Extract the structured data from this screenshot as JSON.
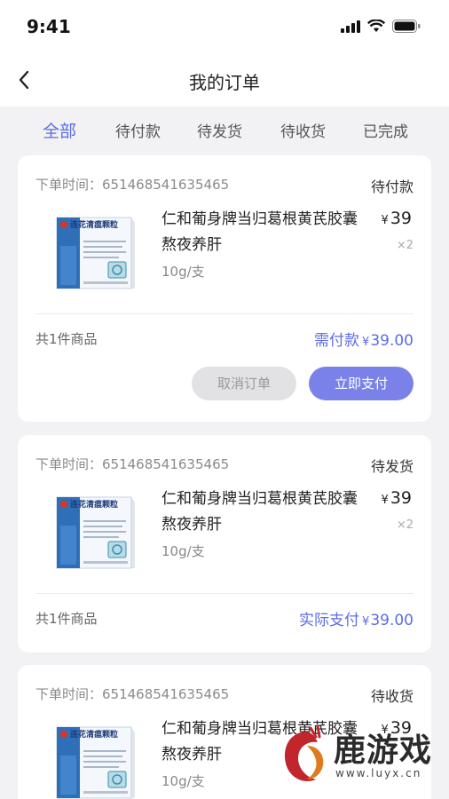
{
  "status_bar": {
    "time": "9:41"
  },
  "header": {
    "title": "我的订单"
  },
  "tabs": [
    {
      "label": "全部",
      "active": true
    },
    {
      "label": "待付款",
      "active": false
    },
    {
      "label": "待发货",
      "active": false
    },
    {
      "label": "待收货",
      "active": false
    },
    {
      "label": "已完成",
      "active": false
    }
  ],
  "orders": [
    {
      "time_label": "下单时间：651468541635465",
      "status": "待付款",
      "product": {
        "name": "仁和葡身牌当归葛根黄芪胶囊熬夜养肝",
        "spec": "10g/支",
        "price_symbol": "¥",
        "price": "39",
        "qty": "×2",
        "box_label": "连花清瘟颗粒"
      },
      "item_count": "共1件商品",
      "total_label": "需付款",
      "total_symbol": "¥",
      "total_value": "39.00",
      "cancel_label": "取消订单",
      "pay_label": "立即支付"
    },
    {
      "time_label": "下单时间：651468541635465",
      "status": "待发货",
      "product": {
        "name": "仁和葡身牌当归葛根黄芪胶囊熬夜养肝",
        "spec": "10g/支",
        "price_symbol": "¥",
        "price": "39",
        "qty": "×2",
        "box_label": "连花清瘟颗粒"
      },
      "item_count": "共1件商品",
      "total_label": "实际支付",
      "total_symbol": "¥",
      "total_value": "39.00"
    },
    {
      "time_label": "下单时间：651468541635465",
      "status": "待收货",
      "product": {
        "name": "仁和葡身牌当归葛根黄芪胶囊熬夜养肝",
        "spec": "10g/支",
        "price_symbol": "¥",
        "price": "39",
        "box_label": "连花清瘟颗粒"
      }
    }
  ],
  "watermark": {
    "text": "鹿游戏",
    "url": "www.luyx.cn"
  },
  "colors": {
    "accent": "#5b6ce8",
    "pay_button": "#7a82ea",
    "background": "#f2f2f4"
  }
}
